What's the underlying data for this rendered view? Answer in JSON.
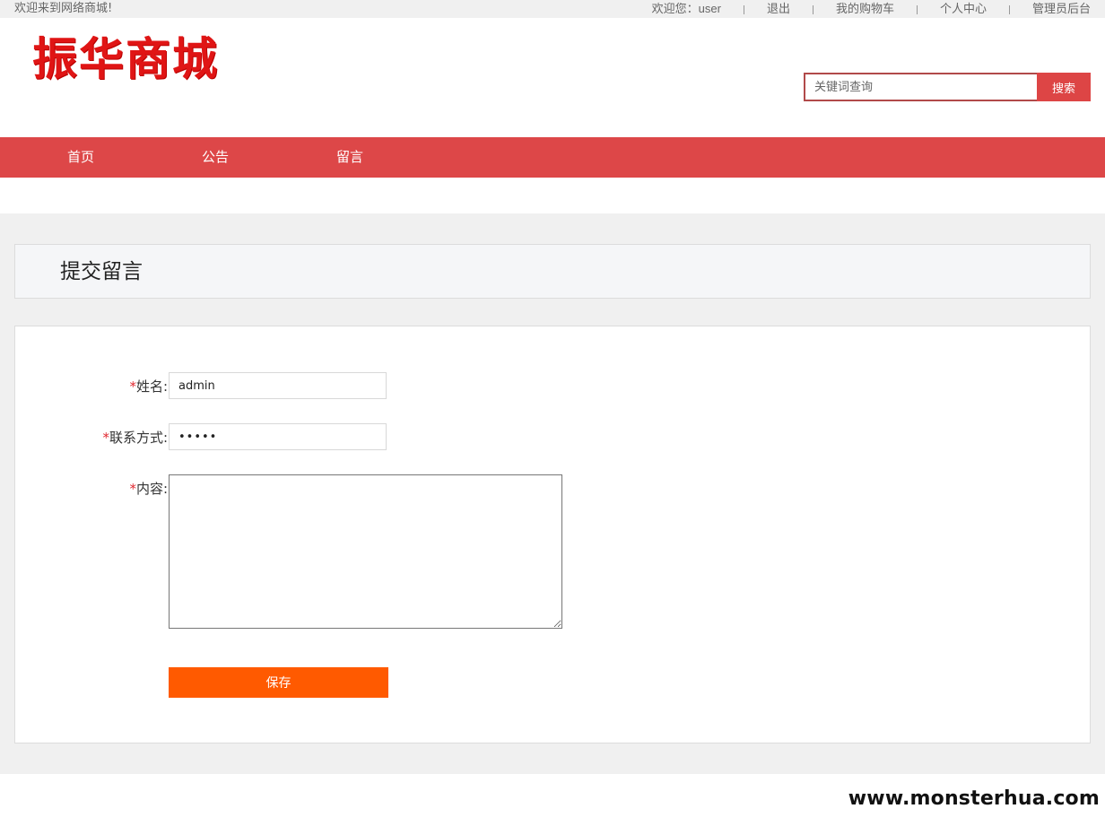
{
  "topbar": {
    "welcome": "欢迎来到网络商城!",
    "greeting": "欢迎您：",
    "username": "user",
    "logout": "退出",
    "cart": "我的购物车",
    "profile": "个人中心",
    "admin": "管理员后台"
  },
  "header": {
    "logo_text": "振华商城",
    "search_placeholder": "关键词查询",
    "search_button": "搜索"
  },
  "nav": {
    "items": [
      {
        "label": "首页"
      },
      {
        "label": "公告"
      },
      {
        "label": "留言"
      }
    ]
  },
  "page": {
    "title": "提交留言"
  },
  "form": {
    "required_mark": "*",
    "name_label": "姓名:",
    "name_value": "admin",
    "contact_label": "联系方式:",
    "contact_value": "•••••",
    "content_label": "内容:",
    "content_value": "",
    "save_button": "保存"
  },
  "watermark": "www.monsterhua.com",
  "colors": {
    "brand_red": "#dd4748",
    "save_orange": "#ff5a00",
    "logo_red": "#e01515"
  }
}
